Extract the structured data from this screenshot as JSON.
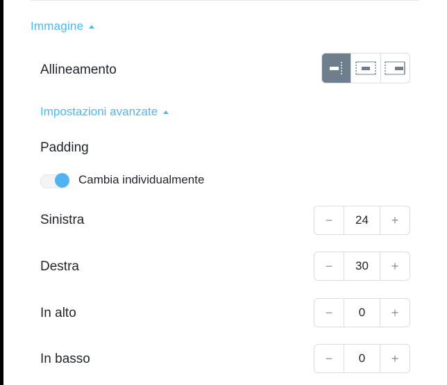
{
  "section": {
    "title": "Immagine"
  },
  "alignment": {
    "label": "Allineamento",
    "options": [
      "align-left-icon",
      "align-center-icon",
      "align-right-icon"
    ],
    "selected_index": 0
  },
  "advanced": {
    "title": "Impostazioni avanzate"
  },
  "padding": {
    "heading": "Padding",
    "individual_toggle": {
      "label": "Cambia individualmente",
      "on": true
    },
    "rows": [
      {
        "label": "Sinistra",
        "value": "24",
        "minus": "−",
        "plus": "+"
      },
      {
        "label": "Destra",
        "value": "30",
        "minus": "−",
        "plus": "+"
      },
      {
        "label": "In alto",
        "value": "0",
        "minus": "−",
        "plus": "+"
      },
      {
        "label": "In basso",
        "value": "0",
        "minus": "−",
        "plus": "+"
      }
    ]
  },
  "colors": {
    "accent": "#4fb6f0",
    "active_segment": "#6f7e8c",
    "toggle_knob": "#52b3f2"
  }
}
